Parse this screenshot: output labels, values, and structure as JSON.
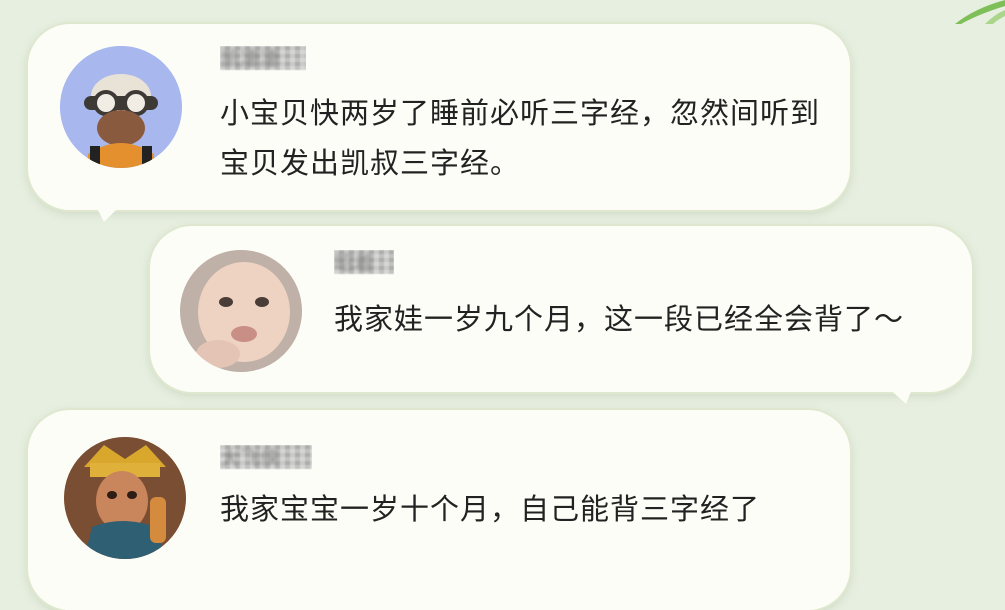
{
  "comments": [
    {
      "username": "凯凄凄",
      "text": "小宝贝快两岁了睡前必听三字经，忽然间听到宝贝发出凯叔三字经。",
      "avatar": "cartoon-avatar-with-glasses"
    },
    {
      "username": "昭着",
      "text": "我家娃一岁九个月，这一段已经全会背了～",
      "avatar": "baby-photo-avatar"
    },
    {
      "username": "大飞侠",
      "text": "我家宝宝一岁十个月，自己能背三字经了",
      "avatar": "costumed-child-avatar"
    }
  ],
  "colors": {
    "background": "#e7efe0",
    "bubble": "#fdfdf8",
    "text": "#222222"
  }
}
